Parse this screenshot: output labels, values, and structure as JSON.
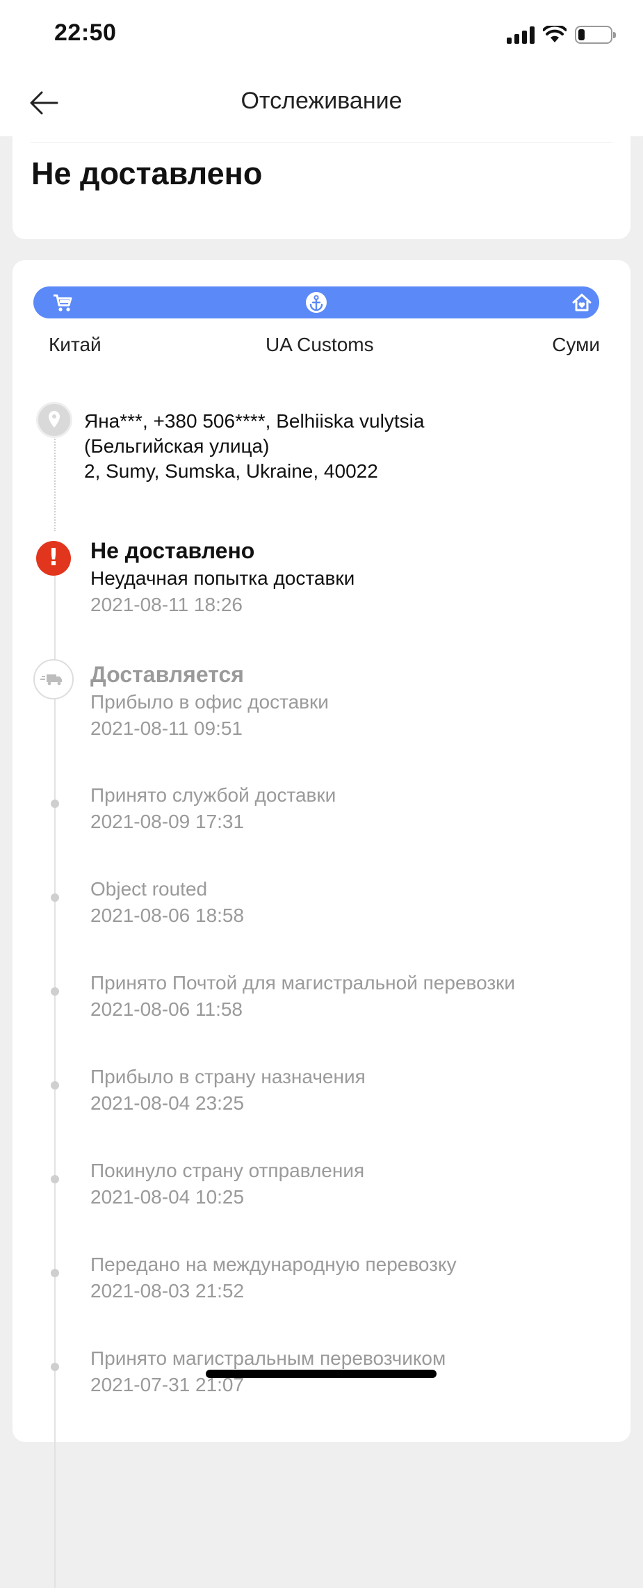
{
  "status_bar": {
    "time": "22:50",
    "icons": [
      "signal-icon",
      "wifi-icon",
      "battery-icon"
    ]
  },
  "header": {
    "title": "Отслеживание",
    "back_icon": "arrow-left-icon"
  },
  "summary": {
    "status": "Не доставлено"
  },
  "route": {
    "color": "#5b89f7",
    "origin": "Китай",
    "customs": "UA Customs",
    "destination": "Суми",
    "icons": [
      "cart-icon",
      "anchor-icon",
      "home-icon"
    ]
  },
  "address": {
    "line1": "Яна***,  +380 506****,  Belhiiska vulytsia",
    "line2": "(Бельгийская улица)",
    "line3": "2,  Sumy,  Sumska,  Ukraine,  40022"
  },
  "events": [
    {
      "title": "Не доставлено",
      "desc": "Неудачная попытка доставки",
      "date": "2021-08-11 18:26"
    },
    {
      "title": "Доставляется",
      "desc": "Прибыло в офис доставки",
      "date": "2021-08-11 09:51"
    },
    {
      "desc": "Принято службой доставки",
      "date": "2021-08-09 17:31"
    },
    {
      "desc": "Object routed",
      "date": "2021-08-06 18:58"
    },
    {
      "desc": "Принято Почтой для магистральной перевозки",
      "date": "2021-08-06 11:58"
    },
    {
      "desc": "Прибыло в страну назначения",
      "date": "2021-08-04 23:25"
    },
    {
      "desc": "Покинуло страну отправления",
      "date": "2021-08-04 10:25"
    },
    {
      "desc": "Передано на международную перевозку",
      "date": "2021-08-03 21:52"
    },
    {
      "desc": "Принято магистральным перевозчиком",
      "date": "2021-07-31 21:07"
    }
  ],
  "colors": {
    "alert": "#e2351d",
    "muted": "#9a9a9a",
    "accent": "#5b89f7"
  }
}
